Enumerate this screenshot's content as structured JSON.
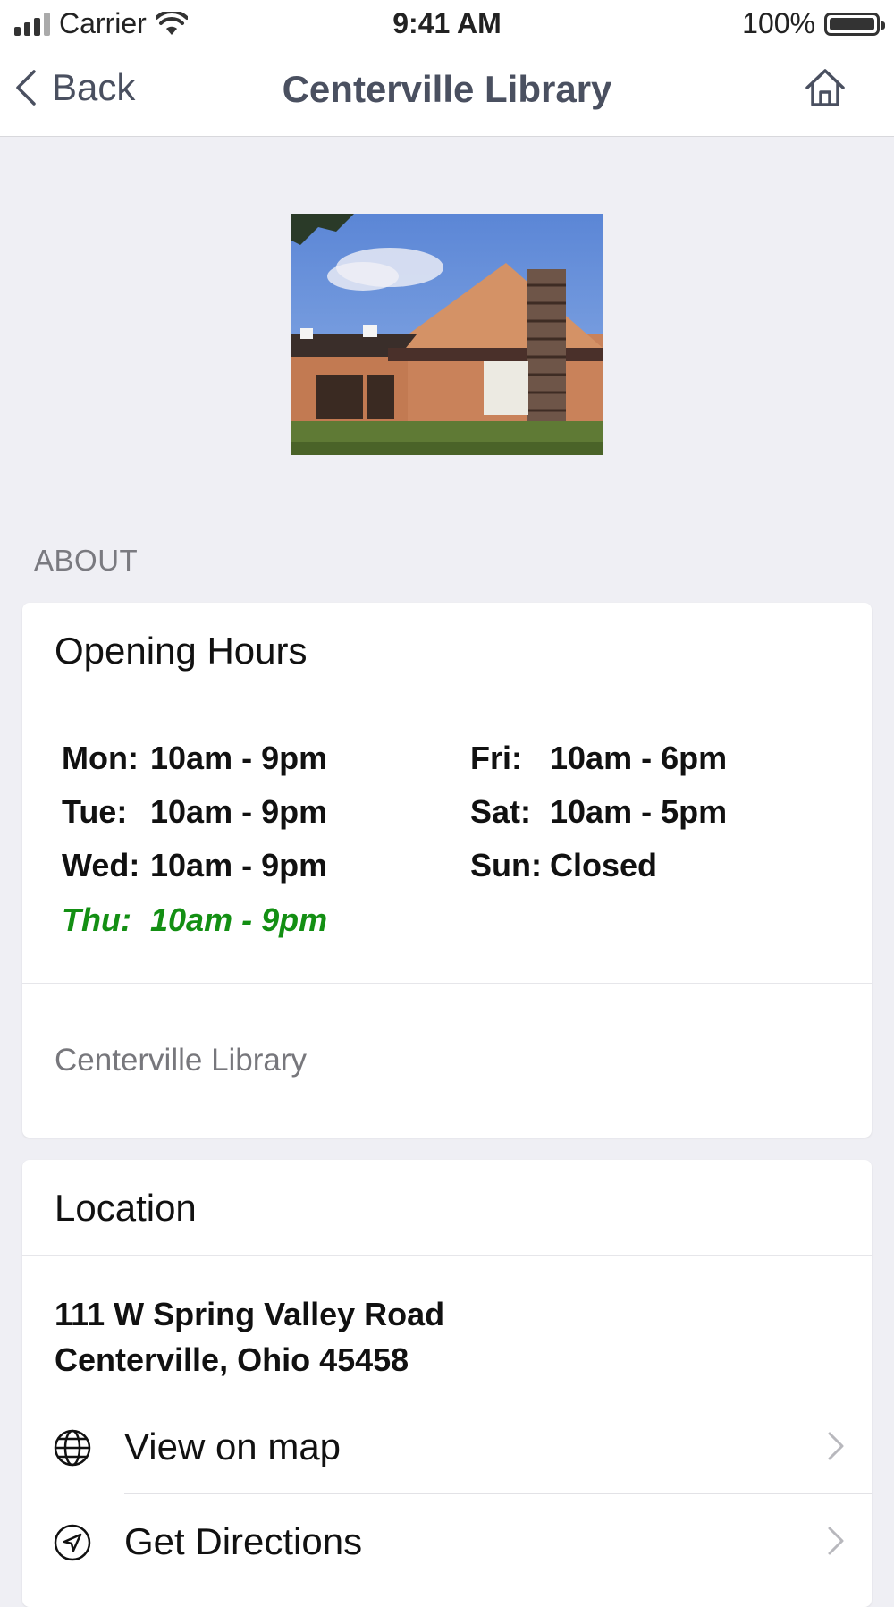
{
  "status_bar": {
    "carrier": "Carrier",
    "time": "9:41 AM",
    "battery": "100%"
  },
  "nav": {
    "back_label": "Back",
    "title": "Centerville Library",
    "home_icon": "home-icon"
  },
  "about": {
    "section_label": "ABOUT",
    "card_title": "Opening Hours",
    "hours": [
      {
        "day": "Mon:",
        "time": "10am - 9pm"
      },
      {
        "day": "Tue:",
        "time": "10am - 9pm"
      },
      {
        "day": "Wed:",
        "time": "10am - 9pm"
      },
      {
        "day": "Thu:",
        "time": "10am - 9pm",
        "today": true
      },
      {
        "day": "Fri:",
        "time": "10am - 6pm"
      },
      {
        "day": "Sat:",
        "time": "10am - 5pm"
      },
      {
        "day": "Sun:",
        "time": "Closed"
      }
    ],
    "today_color": "#138f13",
    "footer": "Centerville Library"
  },
  "location": {
    "card_title": "Location",
    "address_line1": "111 W Spring Valley Road",
    "address_line2": "Centerville, Ohio 45458",
    "actions": [
      {
        "label": "View on map",
        "icon": "globe-icon"
      },
      {
        "label": "Get Directions",
        "icon": "navigation-arrow-icon"
      }
    ]
  }
}
